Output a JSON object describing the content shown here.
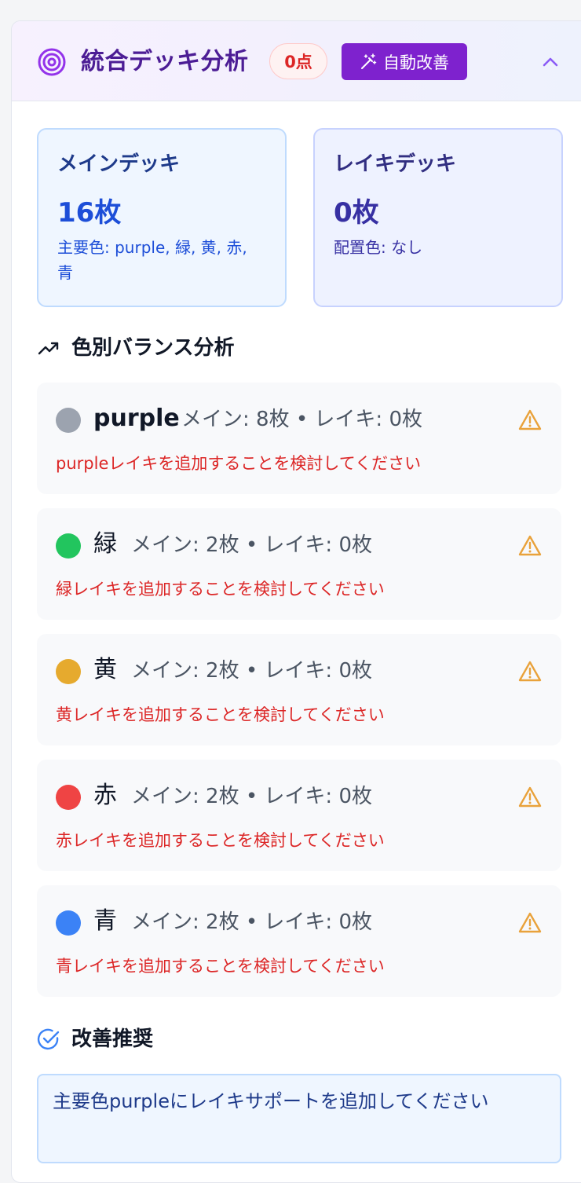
{
  "header": {
    "title": "統合デッキ分析",
    "score": "0点",
    "auto_improve_label": "自動改善",
    "icon": "target-icon",
    "collapse_icon": "chevron-up-icon"
  },
  "decks": {
    "main": {
      "title": "メインデッキ",
      "count": "16枚",
      "detail": "主要色: purple, 緑, 黄, 赤, 青"
    },
    "leiki": {
      "title": "レイキデッキ",
      "count": "0枚",
      "detail": "配置色: なし"
    }
  },
  "balance": {
    "title": "色別バランス分析",
    "rows": [
      {
        "name": "purple",
        "stats": "メイン: 8枚 • レイキ: 0枚",
        "message": "purpleレイキを追加することを検討してください",
        "color": "#9ca3af"
      },
      {
        "name": "緑",
        "stats": "メイン: 2枚 • レイキ: 0枚",
        "message": "緑レイキを追加することを検討してください",
        "color": "#22c55e"
      },
      {
        "name": "黄",
        "stats": "メイン: 2枚 • レイキ: 0枚",
        "message": "黄レイキを追加することを検討してください",
        "color": "#eab308"
      },
      {
        "name": "赤",
        "stats": "メイン: 2枚 • レイキ: 0枚",
        "message": "赤レイキを追加することを検討してください",
        "color": "#ef4444"
      },
      {
        "name": "青",
        "stats": "メイン: 2枚 • レイキ: 0枚",
        "message": "青レイキを追加することを検討してください",
        "color": "#3b82f6"
      }
    ]
  },
  "recommendations": {
    "title": "改善推奨",
    "items": [
      "主要色purpleにレイキサポートを追加してください"
    ]
  },
  "colors": {
    "accent": "#7e22ce",
    "title": "#4c1d95",
    "warning": "#e9a23b",
    "error": "#dc2626"
  }
}
